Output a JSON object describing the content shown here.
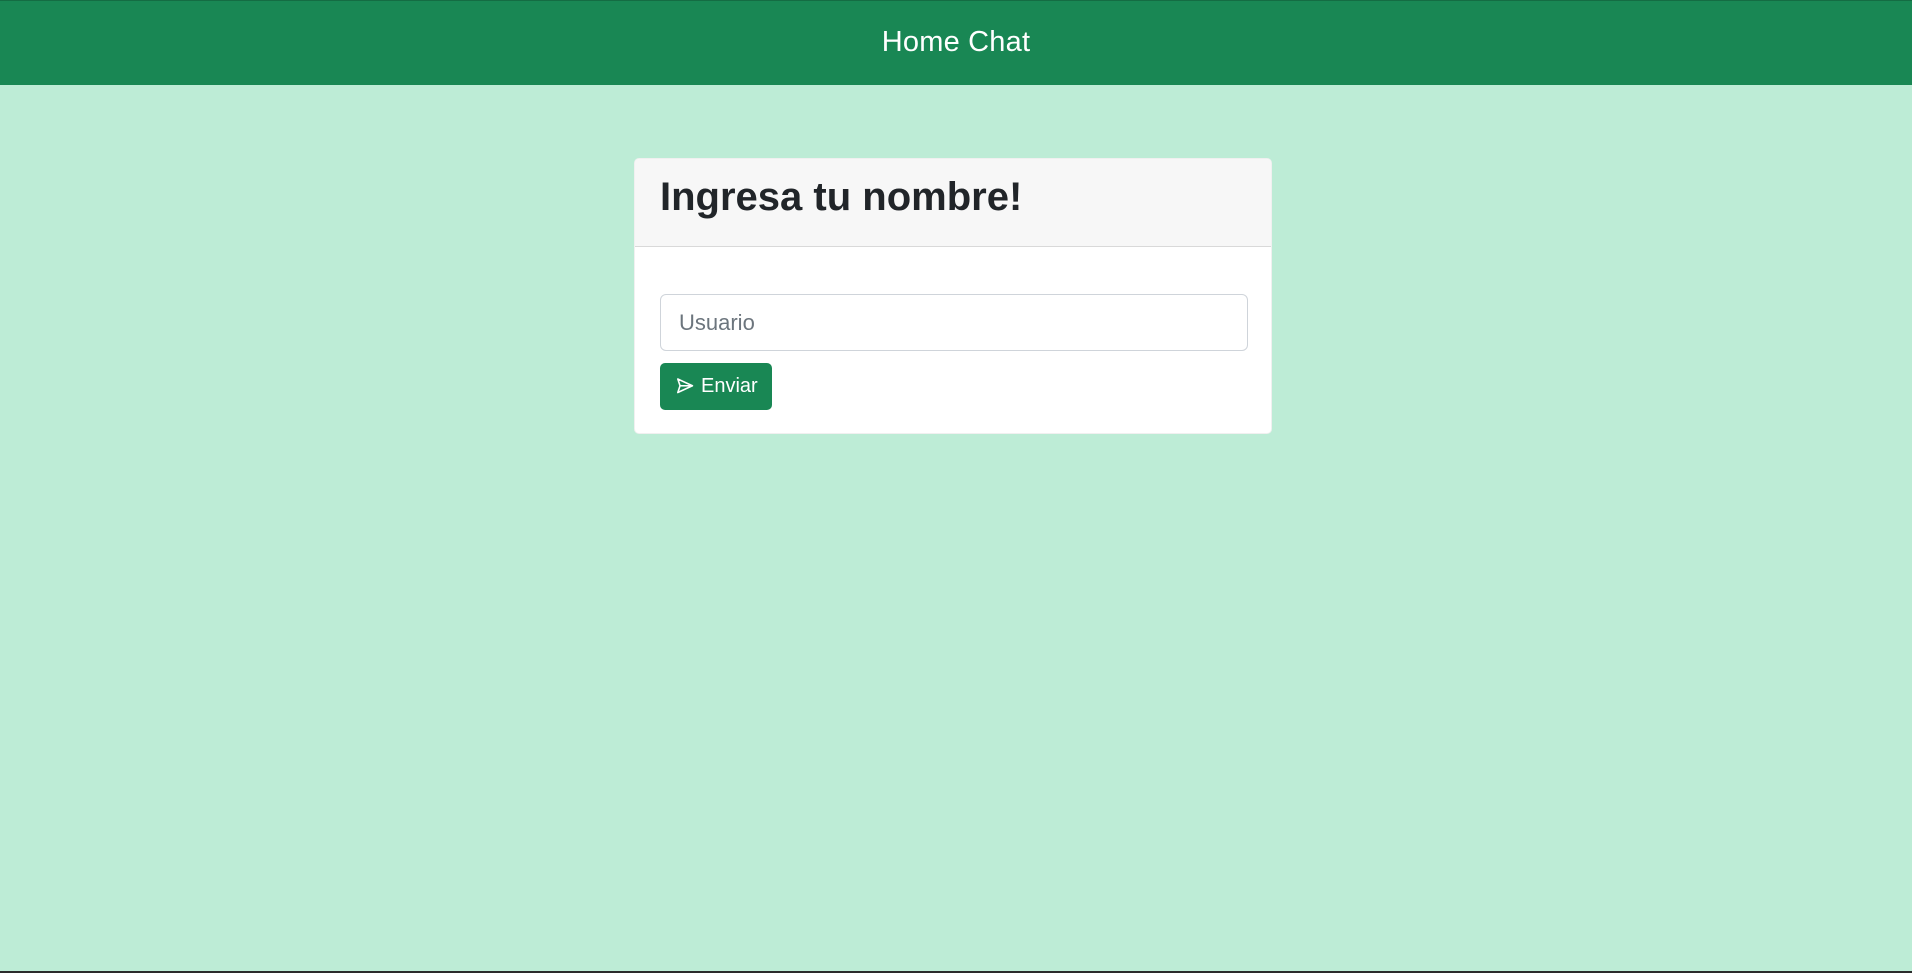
{
  "navbar": {
    "title": "Home Chat"
  },
  "login_card": {
    "title": "Ingresa tu nombre!",
    "username_input": {
      "value": "",
      "placeholder": "Usuario"
    },
    "submit_button": {
      "label": "Enviar",
      "icon": "send-icon"
    }
  },
  "colors": {
    "primary": "#198754",
    "background": "#bdecd6"
  }
}
